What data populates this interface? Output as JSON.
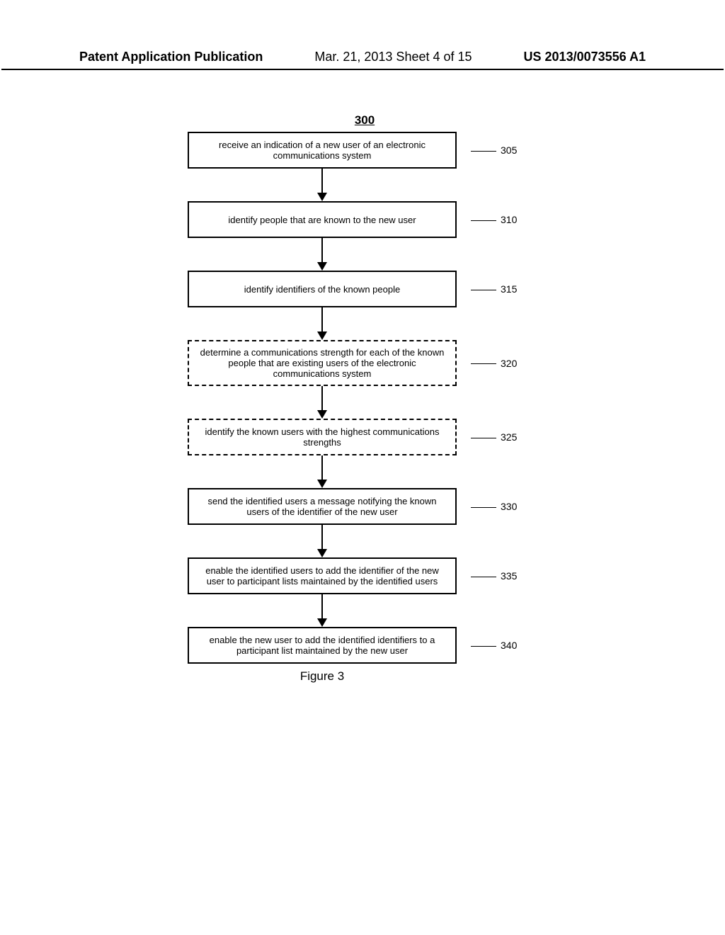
{
  "header": {
    "left": "Patent Application Publication",
    "mid": "Mar. 21, 2013  Sheet 4 of 15",
    "right": "US 2013/0073556 A1"
  },
  "figure": {
    "number_label": "300",
    "caption": "Figure 3",
    "steps": [
      {
        "ref": "305",
        "dashed": false,
        "text": "receive an indication of a new user of an electronic communications system"
      },
      {
        "ref": "310",
        "dashed": false,
        "text": "identify people that are known to the new user"
      },
      {
        "ref": "315",
        "dashed": false,
        "text": "identify identifiers of the known people"
      },
      {
        "ref": "320",
        "dashed": true,
        "text": "determine a communications strength for each of the known people that are existing users of the electronic communications system"
      },
      {
        "ref": "325",
        "dashed": true,
        "text": "identify the known users with the highest communications strengths"
      },
      {
        "ref": "330",
        "dashed": false,
        "text": "send the identified users a message notifying the known users of the identifier of the new user"
      },
      {
        "ref": "335",
        "dashed": false,
        "text": "enable the identified users to add the identifier of the new user to participant lists maintained by the identified users"
      },
      {
        "ref": "340",
        "dashed": false,
        "text": "enable the new user to add the identified identifiers to a participant list maintained by the new user"
      }
    ]
  }
}
